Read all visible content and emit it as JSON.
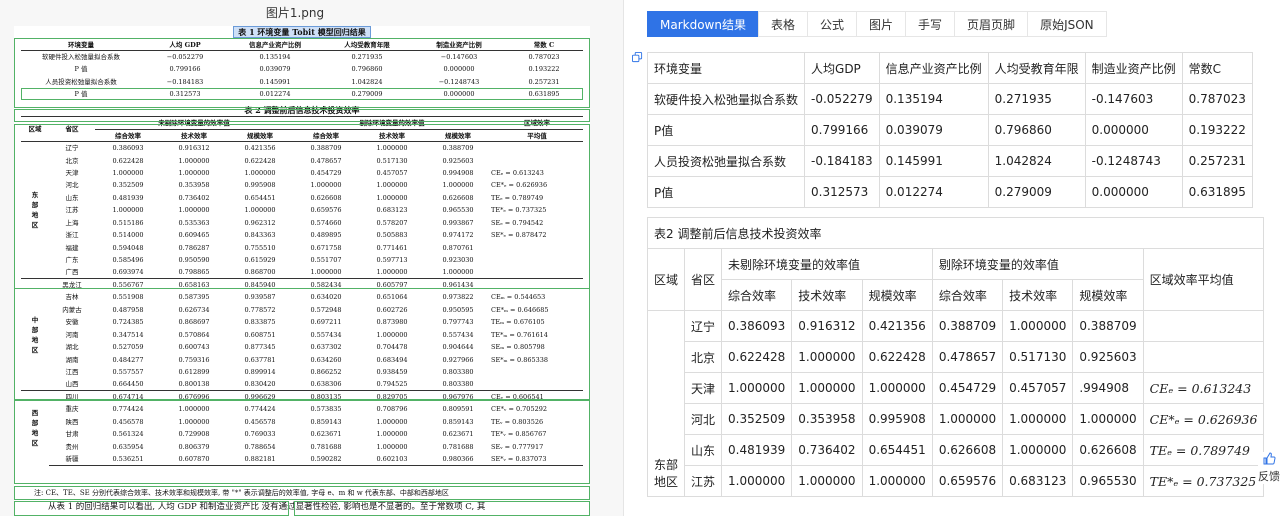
{
  "left": {
    "filename": "图片1.png",
    "table1": {
      "title": "表 1 环境变量 Tobit 模型回归结果",
      "header": [
        "环境变量",
        "人均 GDP",
        "信息产业资产比例",
        "人均受教育年限",
        "制造业资产比例",
        "常数 C"
      ],
      "rows": [
        [
          "软硬件投入松弛量拟合系数",
          "−0.052279",
          "0.135194",
          "0.271935",
          "−0.147603",
          "0.787023"
        ],
        [
          "P 值",
          "0.799166",
          "0.039079",
          "0.796860",
          "0.000000",
          "0.193222"
        ],
        [
          "人员投资松弛量拟合系数",
          "−0.184183",
          "0.145991",
          "1.042824",
          "−0.1248743",
          "0.257231"
        ],
        [
          "P 值",
          "0.312573",
          "0.012274",
          "0.279009",
          "0.000000",
          "0.631895"
        ]
      ]
    },
    "table2": {
      "title": "表 2 调整前后信息技术投资效率",
      "h_region": "区域",
      "h_province": "省区",
      "h_unadjusted": "未剔除环境变量的效率值",
      "h_adjusted": "剔除环境变量的效率值",
      "h_avg1": "区域效率",
      "h_avg2": "平均值",
      "sub": [
        "综合效率",
        "技术效率",
        "规模效率",
        "综合效率",
        "技术效率",
        "规模效率"
      ],
      "groups": [
        {
          "region": "东部地区",
          "rows": [
            [
              "辽宁",
              "0.386093",
              "0.916312",
              "0.421356",
              "0.388709",
              "1.000000",
              "0.388709",
              ""
            ],
            [
              "北京",
              "0.622428",
              "1.000000",
              "0.622428",
              "0.478657",
              "0.517130",
              "0.925603",
              ""
            ],
            [
              "天津",
              "1.000000",
              "1.000000",
              "1.000000",
              "0.454729",
              "0.457057",
              "0.994908",
              "CEₑ = 0.613243"
            ],
            [
              "河北",
              "0.352509",
              "0.353958",
              "0.995908",
              "1.000000",
              "1.000000",
              "1.000000",
              "CE*ₑ = 0.626936"
            ],
            [
              "山东",
              "0.481939",
              "0.736402",
              "0.654451",
              "0.626608",
              "1.000000",
              "0.626608",
              "TEₑ = 0.789749"
            ],
            [
              "江苏",
              "1.000000",
              "1.000000",
              "1.000000",
              "0.659576",
              "0.683123",
              "0.965530",
              "TE*ₑ = 0.737325"
            ],
            [
              "上海",
              "0.515186",
              "0.535363",
              "0.962312",
              "0.574660",
              "0.578207",
              "0.993867",
              "SEₑ = 0.794542"
            ],
            [
              "浙江",
              "0.514000",
              "0.609465",
              "0.843363",
              "0.489895",
              "0.505883",
              "0.974172",
              "SE*ₑ = 0.878472"
            ],
            [
              "福建",
              "0.594048",
              "0.786287",
              "0.755510",
              "0.671758",
              "0.771461",
              "0.870761",
              ""
            ],
            [
              "广东",
              "0.585496",
              "0.950590",
              "0.615929",
              "0.551707",
              "0.597713",
              "0.923030",
              ""
            ],
            [
              "广西",
              "0.693974",
              "0.798865",
              "0.868700",
              "1.000000",
              "1.000000",
              "1.000000",
              ""
            ]
          ]
        },
        {
          "region": "中部地区",
          "rows": [
            [
              "黑龙江",
              "0.556767",
              "0.658163",
              "0.845940",
              "0.582434",
              "0.605797",
              "0.961434",
              ""
            ],
            [
              "吉林",
              "0.551908",
              "0.587395",
              "0.939587",
              "0.634020",
              "0.651064",
              "0.973822",
              "CEₘ = 0.544653"
            ],
            [
              "内蒙古",
              "0.487958",
              "0.626734",
              "0.778572",
              "0.572948",
              "0.602726",
              "0.950595",
              "CE*ₘ = 0.646685"
            ],
            [
              "安徽",
              "0.724385",
              "0.868697",
              "0.833875",
              "0.697211",
              "0.873980",
              "0.797743",
              "TEₘ = 0.676105"
            ],
            [
              "河南",
              "0.347514",
              "0.570864",
              "0.608751",
              "0.557434",
              "1.000000",
              "0.557434",
              "TE*ₘ = 0.761614"
            ],
            [
              "湖北",
              "0.527059",
              "0.600743",
              "0.877345",
              "0.637302",
              "0.704478",
              "0.904644",
              "SEₘ = 0.805798"
            ],
            [
              "湖南",
              "0.484277",
              "0.759316",
              "0.637781",
              "0.634260",
              "0.683494",
              "0.927966",
              "SE*ₘ = 0.865338"
            ],
            [
              "江西",
              "0.557557",
              "0.612899",
              "0.899914",
              "0.866252",
              "0.938459",
              "0.803380",
              ""
            ],
            [
              "山西",
              "0.664450",
              "0.800138",
              "0.830420",
              "0.638306",
              "0.794525",
              "0.803380",
              ""
            ]
          ]
        },
        {
          "region": "西部地区",
          "rows": [
            [
              "四川",
              "0.674714",
              "0.676996",
              "0.996629",
              "0.803135",
              "0.829705",
              "0.967976",
              "CEᵥ = 0.606541"
            ],
            [
              "重庆",
              "0.774424",
              "1.000000",
              "0.774424",
              "0.573835",
              "0.708796",
              "0.809591",
              "CE*ᵥ = 0.705292"
            ],
            [
              "陕西",
              "0.456578",
              "1.000000",
              "0.456578",
              "0.859143",
              "1.000000",
              "0.859143",
              "TEᵥ = 0.803526"
            ],
            [
              "甘肃",
              "0.561324",
              "0.729908",
              "0.769033",
              "0.623671",
              "1.000000",
              "0.623671",
              "TE*ᵥ = 0.856767"
            ],
            [
              "贵州",
              "0.635954",
              "0.806379",
              "0.788654",
              "0.781688",
              "1.000000",
              "0.781688",
              "SEᵥ = 0.777917"
            ],
            [
              "新疆",
              "0.536251",
              "0.607870",
              "0.882181",
              "0.590282",
              "0.602103",
              "0.980366",
              "SE*ᵥ = 0.837073"
            ]
          ]
        }
      ],
      "note": "注: CE、TE、SE 分别代表综合效率、技术效率和规模效率, 带 \"*\" 表示调整后的效率值, 字母 e、m 和 w 代表东部、中部和西部地区",
      "body_text": "从表 1 的回归结果可以看出, 人均 GDP 和制造业资产比     没有通过显著性检验, 影响也是不显著的。至于常数项 C, 其"
    }
  },
  "right": {
    "tabs": [
      "Markdown结果",
      "表格",
      "公式",
      "图片",
      "手写",
      "页眉页脚",
      "原始JSON"
    ],
    "active_tab": "Markdown结果",
    "table1": {
      "header": [
        "环境变量",
        "人均GDP",
        "信息产业资产比例",
        "人均受教育年限",
        "制造业资产比例",
        "常数C"
      ],
      "rows": [
        [
          "软硬件投入松弛量拟合系数",
          "-0.052279",
          "0.135194",
          "0.271935",
          "-0.147603",
          "0.787023"
        ],
        [
          "P值",
          "0.799166",
          "0.039079",
          "0.796860",
          "0.000000",
          "0.193222"
        ],
        [
          "人员投资松弛量拟合系数",
          "-0.184183",
          "0.145991",
          "1.042824",
          "-0.1248743",
          "0.257231"
        ],
        [
          "P值",
          "0.312573",
          "0.012274",
          "0.279009",
          "0.000000",
          "0.631895"
        ]
      ]
    },
    "table2": {
      "title": "表2 调整前后信息技术投资效率",
      "h_region": "区域",
      "h_province": "省区",
      "h_unadjusted": "未剔除环境变量的效率值",
      "h_adjusted": "剔除环境变量的效率值",
      "h_avg": "区域效率平均值",
      "sub": [
        "综合效率",
        "技术效率",
        "规模效率",
        "综合效率",
        "技术效率",
        "规模效率"
      ],
      "region_east": "东部地区",
      "rows": [
        [
          "辽宁",
          "0.386093",
          "0.916312",
          "0.421356",
          "0.388709",
          "1.000000",
          "0.388709",
          ""
        ],
        [
          "北京",
          "0.622428",
          "1.000000",
          "0.622428",
          "0.478657",
          "0.517130",
          "0.925603",
          ""
        ],
        [
          "天津",
          "1.000000",
          "1.000000",
          "1.000000",
          "0.454729",
          "0.457057",
          ".994908",
          "CEₑ = 0.613243"
        ],
        [
          "河北",
          "0.352509",
          "0.353958",
          "0.995908",
          "1.000000",
          "1.000000",
          "1.000000",
          "CE*ₑ = 0.626936"
        ],
        [
          "山东",
          "0.481939",
          "0.736402",
          "0.654451",
          "0.626608",
          "1.000000",
          "0.626608",
          "TEₑ = 0.789749"
        ],
        [
          "江苏",
          "1.000000",
          "1.000000",
          "1.000000",
          "0.659576",
          "0.683123",
          "0.965530",
          "TE*ₑ = 0.737325"
        ]
      ]
    },
    "feedback_label": "反馈"
  }
}
